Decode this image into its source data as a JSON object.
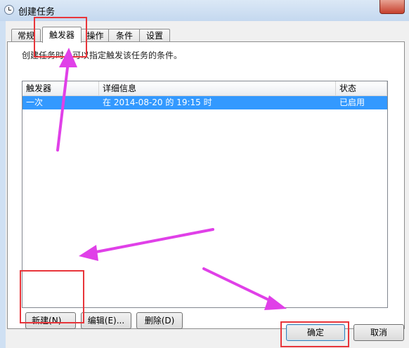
{
  "window": {
    "title": "创建任务"
  },
  "tabs": [
    {
      "label": "常规"
    },
    {
      "label": "触发器"
    },
    {
      "label": "操作"
    },
    {
      "label": "条件"
    },
    {
      "label": "设置"
    }
  ],
  "active_tab": "触发器",
  "description": "创建任务时，可以指定触发该任务的条件。",
  "table": {
    "columns": [
      "触发器",
      "详细信息",
      "状态"
    ],
    "rows": [
      {
        "trigger": "一次",
        "details": "在 2014-08-20 的 19:15 时",
        "status": "已启用",
        "selected": true
      }
    ]
  },
  "buttons": {
    "new": "新建(N)...",
    "edit": "编辑(E)...",
    "delete": "删除(D)",
    "ok": "确定",
    "cancel": "取消"
  },
  "colors": {
    "selection": "#3399ff",
    "annotation_box": "#e8353a",
    "annotation_arrow": "#e040e8"
  }
}
